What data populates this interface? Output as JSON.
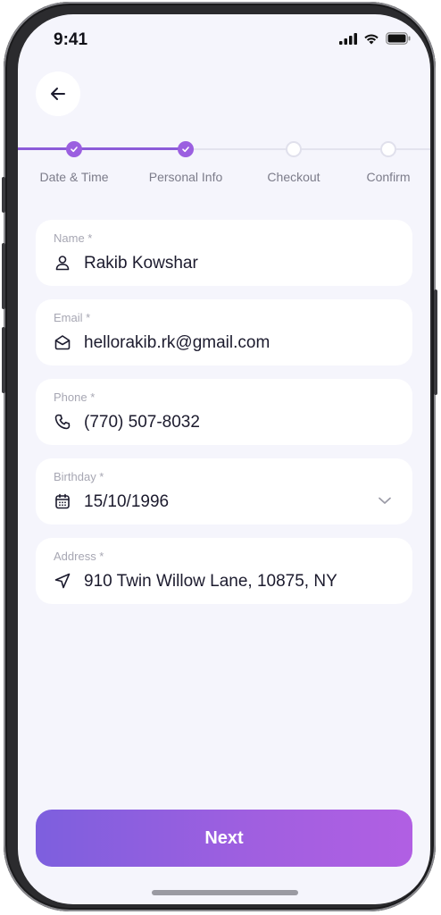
{
  "status_bar": {
    "time": "9:41"
  },
  "stepper": {
    "steps": [
      {
        "label": "Date &  Time",
        "state": "done"
      },
      {
        "label": "Personal Info",
        "state": "done"
      },
      {
        "label": "Checkout",
        "state": "todo"
      },
      {
        "label": "Confirm",
        "state": "todo"
      }
    ]
  },
  "form": {
    "name": {
      "label": "Name *",
      "value": "Rakib Kowshar",
      "icon": "user-icon"
    },
    "email": {
      "label": "Email *",
      "value": "hellorakib.rk@gmail.com",
      "icon": "mail-icon"
    },
    "phone": {
      "label": "Phone *",
      "value": "(770) 507-8032",
      "icon": "phone-icon"
    },
    "birthday": {
      "label": "Birthday *",
      "value": "15/10/1996",
      "icon": "calendar-icon"
    },
    "address": {
      "label": "Address *",
      "value": "910 Twin Willow Lane, 10875, NY",
      "icon": "navigation-icon"
    }
  },
  "actions": {
    "next_label": "Next"
  },
  "colors": {
    "accent": "#9b5fe0",
    "background": "#f5f5fc",
    "text": "#1c1b2e"
  }
}
